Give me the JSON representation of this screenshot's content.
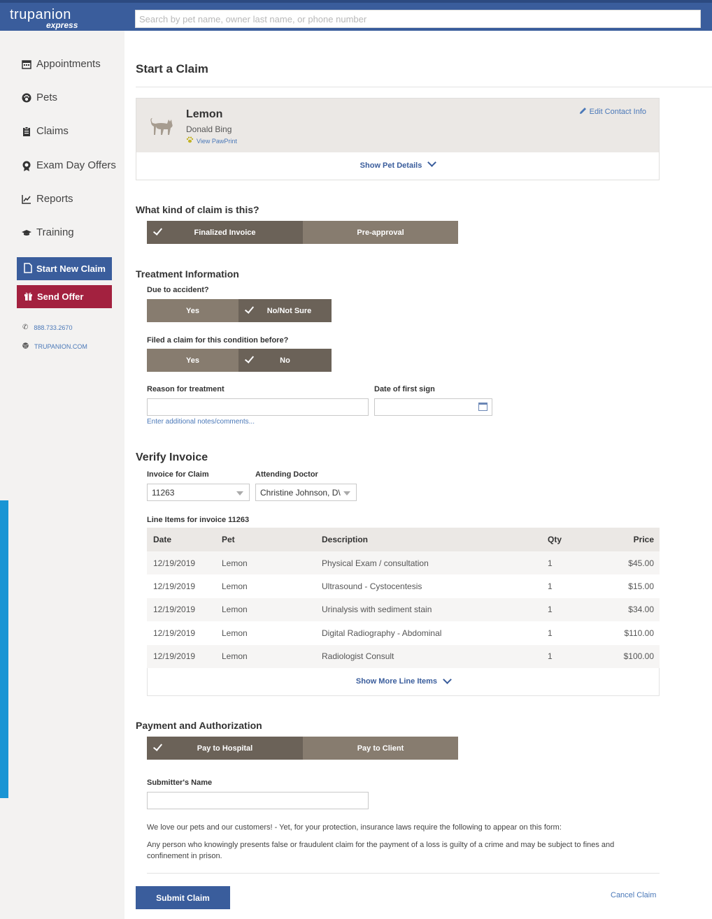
{
  "app": {
    "brand": "trupanion",
    "brand_sub": "express",
    "search_placeholder": "Search by pet name, owner last name, or phone number"
  },
  "sidebar": {
    "items": [
      {
        "label": "Appointments",
        "icon": "calendar-icon"
      },
      {
        "label": "Pets",
        "icon": "paw-icon"
      },
      {
        "label": "Claims",
        "icon": "clipboard-icon"
      },
      {
        "label": "Exam Day Offers",
        "icon": "ribbon-icon"
      },
      {
        "label": "Reports",
        "icon": "chart-icon"
      },
      {
        "label": "Training",
        "icon": "graduation-cap-icon"
      }
    ],
    "start_new_claim": "Start New Claim",
    "send_offer": "Send Offer",
    "phone": "888.733.2670",
    "website": "TRUPANION.COM"
  },
  "page": {
    "title": "Start a Claim"
  },
  "pet": {
    "name": "Lemon",
    "owner": "Donald Bing",
    "pawprint_link": "View PawPrint",
    "edit_contact": "Edit Contact Info",
    "show_details": "Show Pet Details"
  },
  "claim_kind": {
    "heading": "What kind of claim is this?",
    "options": [
      "Finalized Invoice",
      "Pre-approval"
    ],
    "selected": "Finalized Invoice"
  },
  "treatment": {
    "heading": "Treatment Information",
    "accident_label": "Due to accident?",
    "accident_options": [
      "Yes",
      "No/Not Sure"
    ],
    "accident_selected": "No/Not Sure",
    "filed_label": "Filed a claim for this condition before?",
    "filed_options": [
      "Yes",
      "No"
    ],
    "filed_selected": "No",
    "reason_label": "Reason for treatment",
    "reason_value": "",
    "date_label": "Date of first sign",
    "date_value": "",
    "notes_link": "Enter additional notes/comments..."
  },
  "invoice": {
    "heading": "Verify Invoice",
    "invoice_label": "Invoice for Claim",
    "invoice_value": "11263",
    "doctor_label": "Attending Doctor",
    "doctor_value": "Christine Johnson, D\\",
    "line_items_label": "Line Items for invoice 11263",
    "columns": [
      "Date",
      "Pet",
      "Description",
      "Qty",
      "Price"
    ],
    "rows": [
      [
        "12/19/2019",
        "Lemon",
        "Physical Exam / consultation",
        "1",
        "$45.00"
      ],
      [
        "12/19/2019",
        "Lemon",
        "Ultrasound - Cystocentesis",
        "1",
        "$15.00"
      ],
      [
        "12/19/2019",
        "Lemon",
        "Urinalysis with sediment stain",
        "1",
        "$34.00"
      ],
      [
        "12/19/2019",
        "Lemon",
        "Digital Radiography - Abdominal",
        "1",
        "$110.00"
      ],
      [
        "12/19/2019",
        "Lemon",
        "Radiologist Consult",
        "1",
        "$100.00"
      ]
    ],
    "show_more": "Show More Line Items"
  },
  "payment": {
    "heading": "Payment and Authorization",
    "options": [
      "Pay to Hospital",
      "Pay to Client"
    ],
    "selected": "Pay to Hospital",
    "submitter_label": "Submitter's Name",
    "submitter_value": ""
  },
  "legal": {
    "line1": "We love our pets and our customers! - Yet, for your protection, insurance laws require the following to appear on this form:",
    "line2": "Any person who knowingly presents false or fraudulent claim for the payment of a loss is guilty of a crime and may be subject to fines and confinement in prison."
  },
  "actions": {
    "submit": "Submit Claim",
    "cancel": "Cancel Claim"
  },
  "colors": {
    "header": "#3a5d9c",
    "sidebar_bg": "#f3f2f1",
    "start_claim_btn": "#3a5d9c",
    "send_offer_btn": "#a3213f",
    "seg_selected": "#6b6258",
    "seg_unselected": "#877c6f",
    "link": "#4a78b8",
    "accent_strip": "#1a95d4"
  }
}
